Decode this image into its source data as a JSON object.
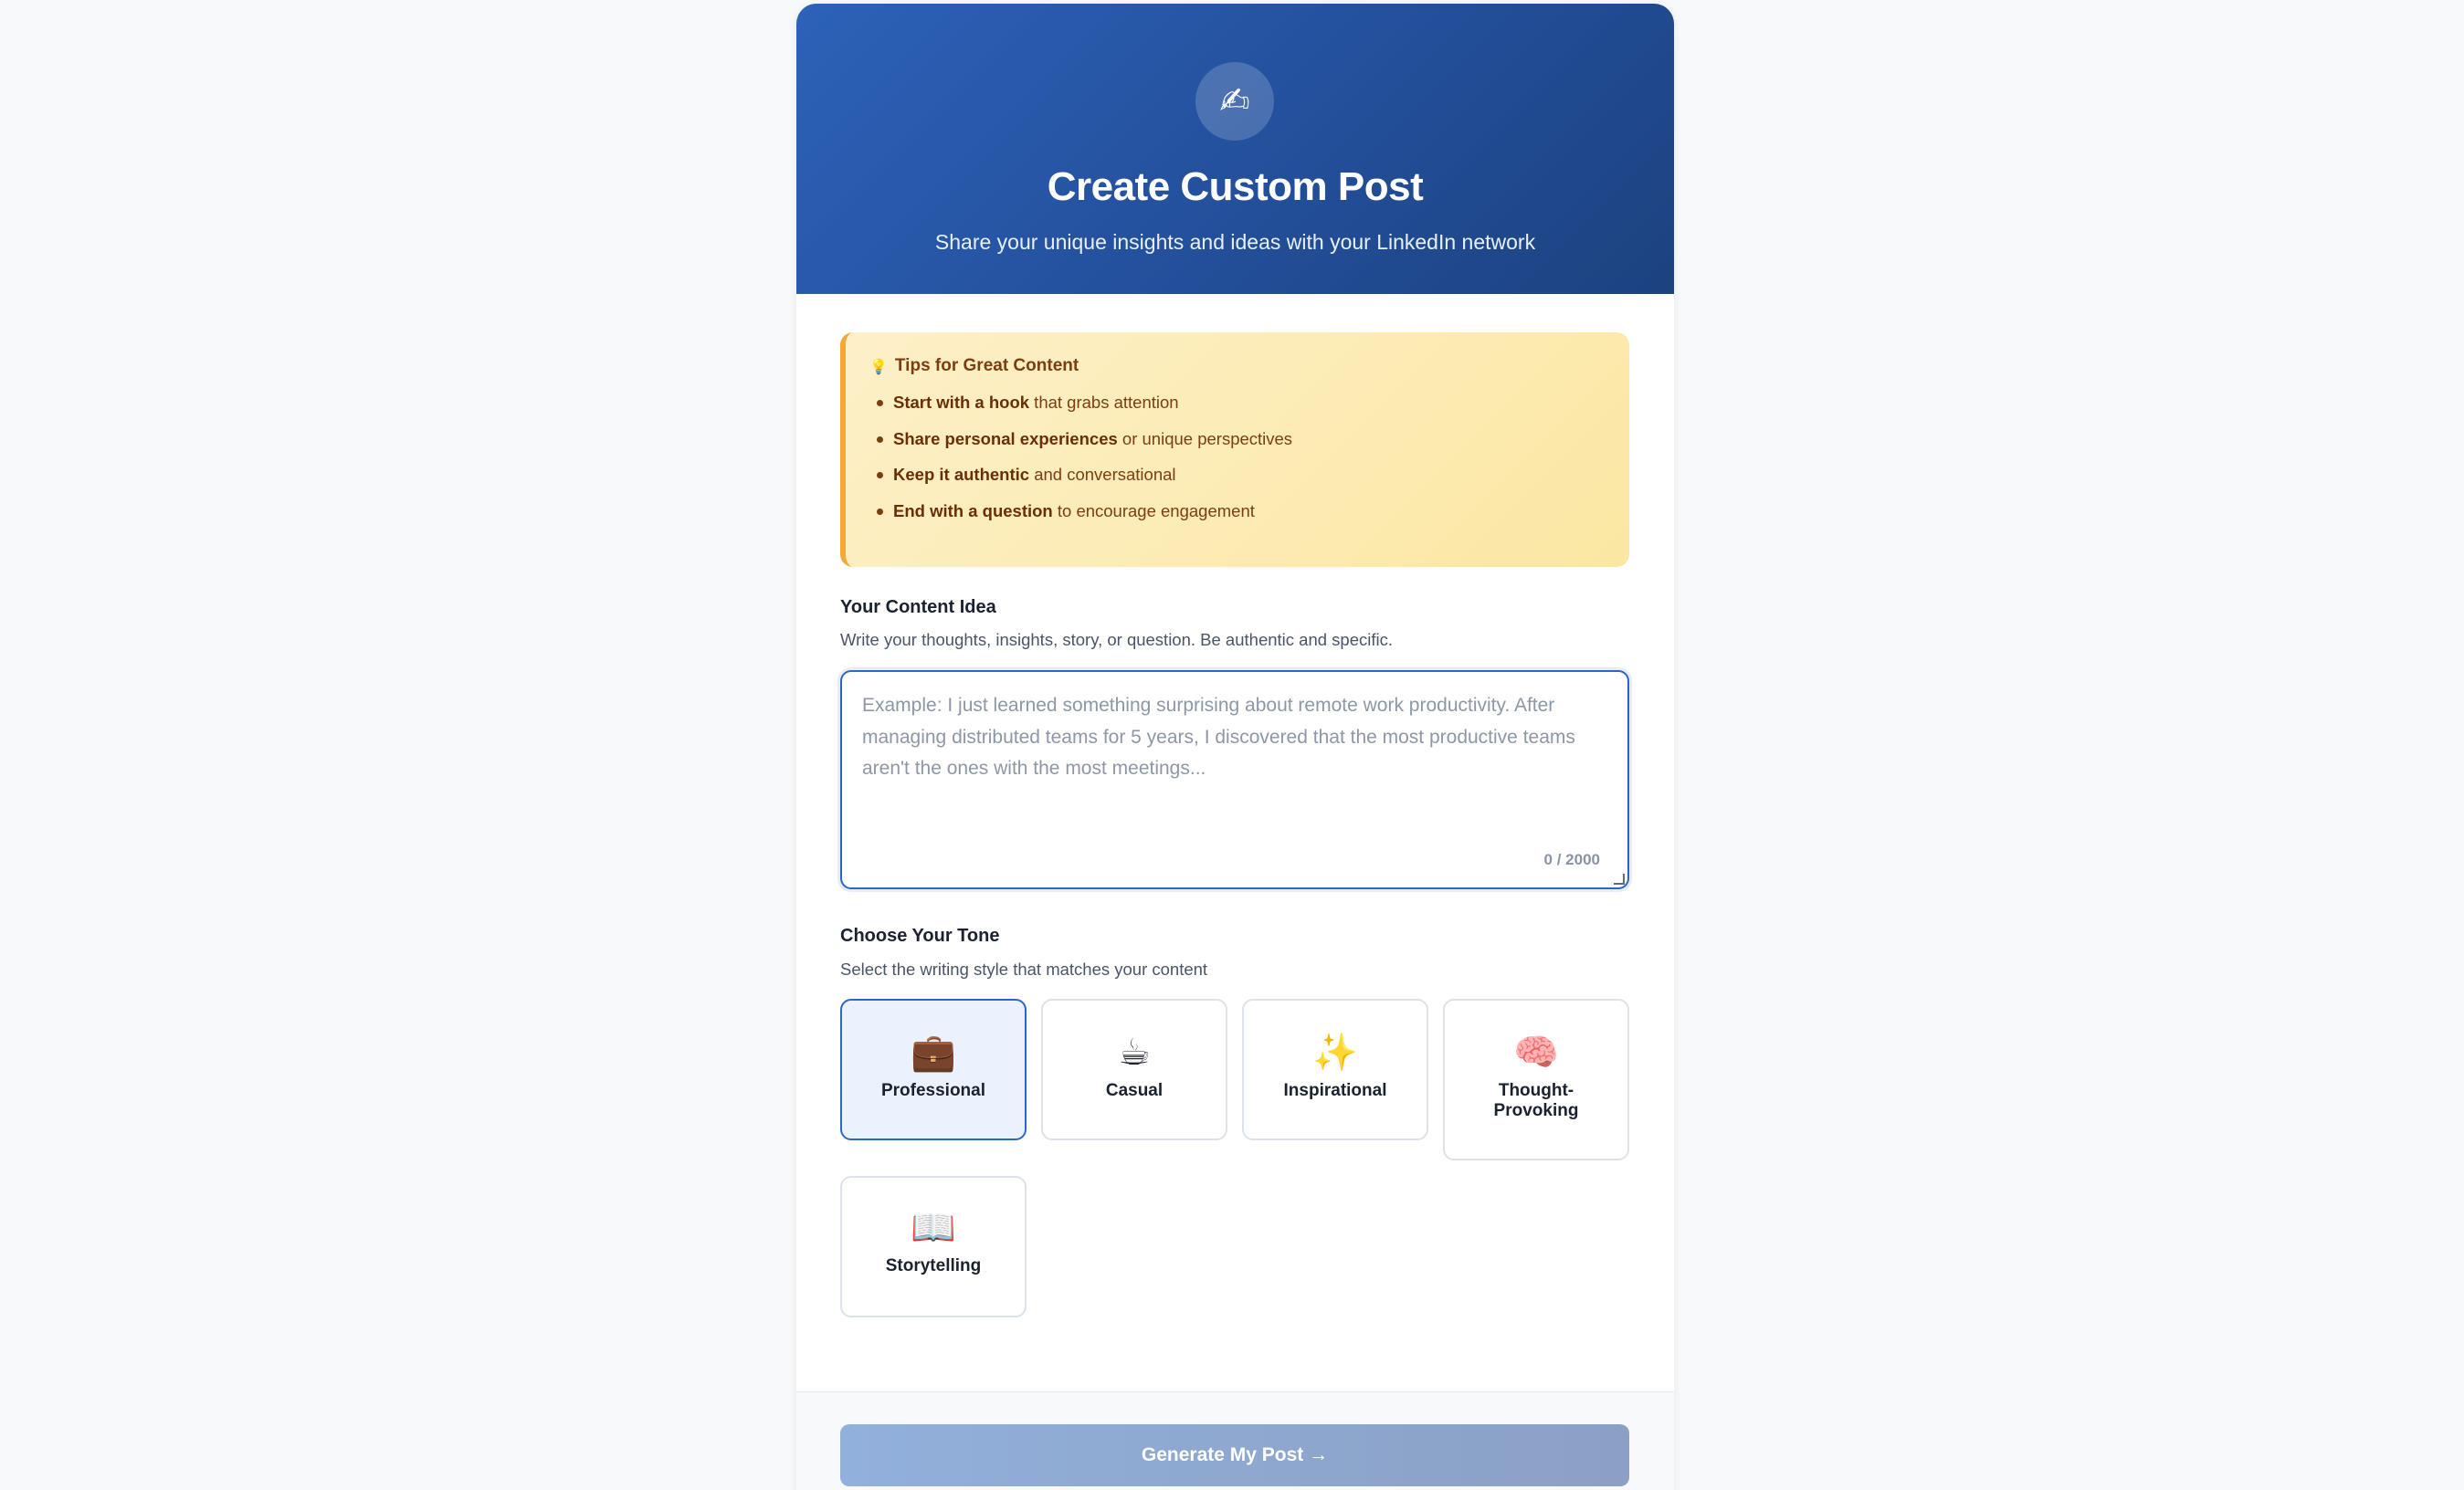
{
  "header": {
    "icon": "writing-hand-icon",
    "icon_glyph": "✍",
    "title": "Create Custom Post",
    "subtitle": "Share your unique insights and ideas with your LinkedIn network"
  },
  "tips": {
    "icon": "lightbulb-icon",
    "icon_glyph": "💡",
    "title": "Tips for Great Content",
    "items": [
      {
        "bold": "Start with a hook",
        "rest": " that grabs attention"
      },
      {
        "bold": "Share personal experiences",
        "rest": " or unique perspectives"
      },
      {
        "bold": "Keep it authentic",
        "rest": " and conversational"
      },
      {
        "bold": "End with a question",
        "rest": " to encourage engagement"
      }
    ]
  },
  "content": {
    "label": "Your Content Idea",
    "hint": "Write your thoughts, insights, story, or question. Be authentic and specific.",
    "value": "",
    "placeholder": "Example: I just learned something surprising about remote work productivity. After managing distributed teams for 5 years, I discovered that the most productive teams aren't the ones with the most meetings...",
    "counter": "0 / 2000"
  },
  "tone": {
    "label": "Choose Your Tone",
    "hint": "Select the writing style that matches your content",
    "selected": "Professional",
    "options": [
      {
        "label": "Professional",
        "icon": "briefcase-icon",
        "glyph": "💼"
      },
      {
        "label": "Casual",
        "icon": "coffee-icon",
        "glyph": "☕"
      },
      {
        "label": "Inspirational",
        "icon": "sparkles-icon",
        "glyph": "✨"
      },
      {
        "label": "Thought-Provoking",
        "icon": "brain-icon",
        "glyph": "🧠"
      },
      {
        "label": "Storytelling",
        "icon": "open-book-icon",
        "glyph": "📖"
      }
    ]
  },
  "footer": {
    "generate_label": "Generate My Post →"
  },
  "colors": {
    "primary": "#2f66c4",
    "header_start": "#2c62b8",
    "header_end": "#1c427f",
    "tips_bg": "#fdf0c8",
    "tips_border": "#f0a93a",
    "tips_text": "#7a3f10",
    "button_disabled": "#91b0db"
  }
}
